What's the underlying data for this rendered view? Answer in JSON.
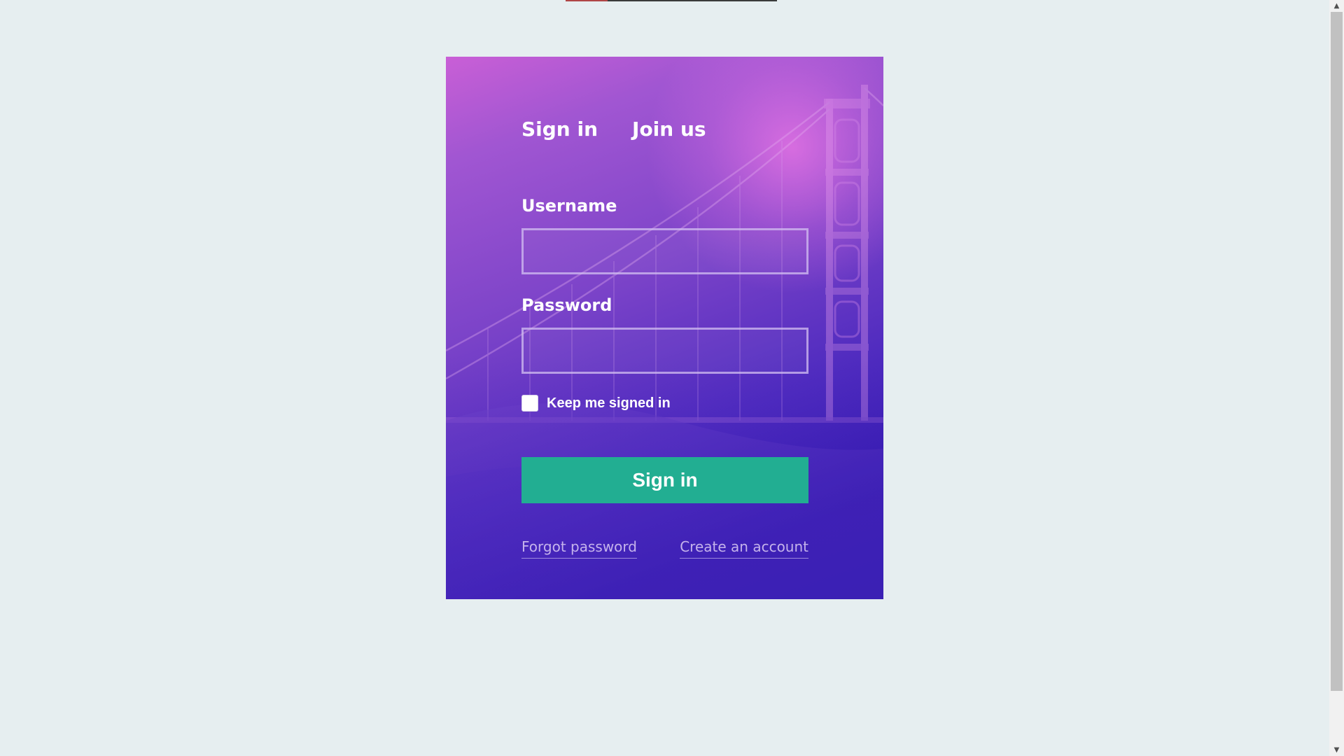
{
  "tabs": {
    "signin": "Sign in",
    "join": "Join us"
  },
  "form": {
    "username_label": "Username",
    "username_value": "",
    "password_label": "Password",
    "password_value": "",
    "remember_label": "Keep me signed in",
    "remember_checked": false,
    "submit_label": "Sign in"
  },
  "links": {
    "forgot": "Forgot password",
    "create": "Create an account"
  },
  "scrollbar": {
    "up_icon": "▲",
    "down_icon": "▼"
  },
  "colors": {
    "page_background": "#e6eef0",
    "button": "#22ae92",
    "card_gradient_top": "#c95fd6",
    "card_gradient_bottom": "#2c17ad"
  }
}
